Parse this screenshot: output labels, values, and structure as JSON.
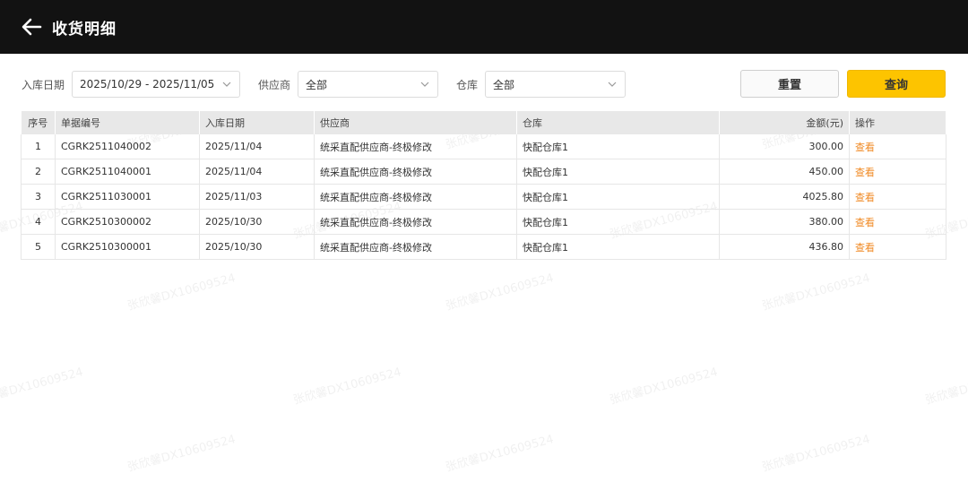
{
  "header": {
    "title": "收货明细"
  },
  "filters": {
    "date_label": "入库日期",
    "date_value": "2025/10/29 - 2025/11/05",
    "supplier_label": "供应商",
    "supplier_value": "全部",
    "warehouse_label": "仓库",
    "warehouse_value": "全部",
    "reset_label": "重置",
    "query_label": "查询"
  },
  "table": {
    "columns": [
      "序号",
      "单据编号",
      "入库日期",
      "供应商",
      "仓库",
      "金额(元)",
      "操作"
    ],
    "rows": [
      {
        "index": "1",
        "doc_no": "CGRK2511040002",
        "date": "2025/11/04",
        "supplier": "统采直配供应商-终极修改",
        "warehouse": "快配仓库1",
        "amount": "300.00",
        "action": "查看"
      },
      {
        "index": "2",
        "doc_no": "CGRK2511040001",
        "date": "2025/11/04",
        "supplier": "统采直配供应商-终极修改",
        "warehouse": "快配仓库1",
        "amount": "450.00",
        "action": "查看"
      },
      {
        "index": "3",
        "doc_no": "CGRK2511030001",
        "date": "2025/11/03",
        "supplier": "统采直配供应商-终极修改",
        "warehouse": "快配仓库1",
        "amount": "4025.80",
        "action": "查看"
      },
      {
        "index": "4",
        "doc_no": "CGRK2510300002",
        "date": "2025/10/30",
        "supplier": "统采直配供应商-终极修改",
        "warehouse": "快配仓库1",
        "amount": "380.00",
        "action": "查看"
      },
      {
        "index": "5",
        "doc_no": "CGRK2510300001",
        "date": "2025/10/30",
        "supplier": "统采直配供应商-终极修改",
        "warehouse": "快配仓库1",
        "amount": "436.80",
        "action": "查看"
      }
    ]
  },
  "watermark": "张欣馨DX10609524",
  "colors": {
    "header_bg": "#121212",
    "query_button": "#fdc400",
    "link": "#f08a24"
  }
}
